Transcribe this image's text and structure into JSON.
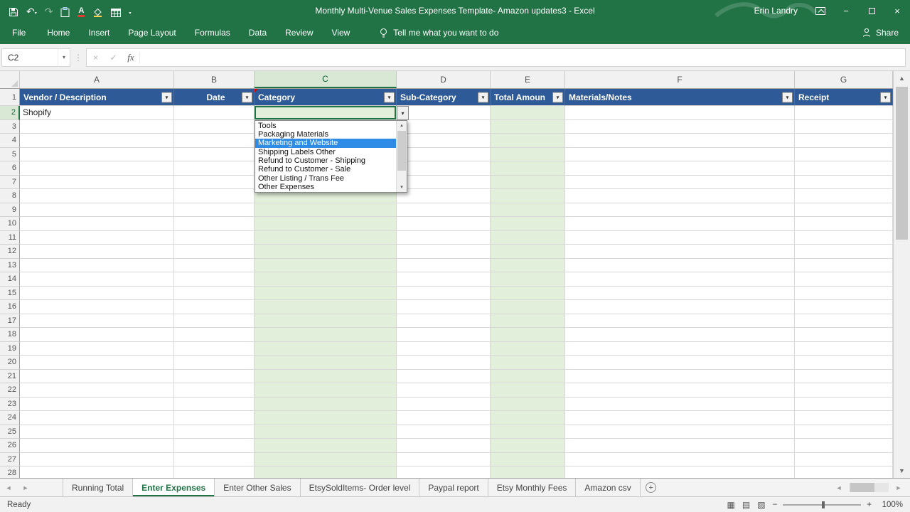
{
  "colors": {
    "excel-green": "#217346",
    "header-blue": "#2E5B97",
    "fill-green": "#E2EFDA",
    "selection-blue": "#2E8BE6",
    "grid-line": "#D8D8D8"
  },
  "titlebar": {
    "title": "Monthly Multi-Venue Sales Expenses Template- Amazon updates3 - Excel",
    "user": "Erin Landry"
  },
  "ribbon": {
    "tabs": [
      "File",
      "Home",
      "Insert",
      "Page Layout",
      "Formulas",
      "Data",
      "Review",
      "View"
    ],
    "tell_me": "Tell me what you want to do",
    "share": "Share"
  },
  "formula_bar": {
    "name_box": "C2",
    "fx": "fx"
  },
  "grid": {
    "columns": [
      "A",
      "B",
      "C",
      "D",
      "E",
      "F",
      "G"
    ],
    "row_count": 28,
    "active_cell": "C2",
    "green_columns": [
      "C",
      "E"
    ],
    "header_row": [
      "Vendor / Description",
      "Date",
      "Category",
      "Sub-Category",
      "Total Amoun",
      "Materials/Notes",
      "Receipt"
    ],
    "cells": {
      "A2": "Shopify"
    }
  },
  "dropdown": {
    "items": [
      "Tools",
      "Packaging Materials",
      "Marketing and Website",
      "Shipping Labels Other",
      "Refund to Customer - Shipping",
      "Refund to Customer - Sale",
      "Other Listing / Trans Fee",
      "Other Expenses"
    ],
    "selected": "Marketing and Website"
  },
  "sheet_tabs": {
    "tabs": [
      "Running Total",
      "Enter Expenses",
      "Enter Other Sales",
      "EtsySoldItems- Order level",
      "Paypal report",
      "Etsy Monthly Fees",
      "Amazon csv"
    ],
    "active": "Enter Expenses"
  },
  "status_bar": {
    "status": "Ready",
    "zoom": "100%"
  },
  "icons": {
    "filter_arrow": "▾",
    "dropdown_arrow": "▾",
    "undo": "↶",
    "redo": "↷",
    "font_color": "A",
    "customize": "▾",
    "scroll_up": "▲",
    "scroll_down": "▼",
    "nav_left": "◄",
    "nav_right": "►",
    "small_up": "▴",
    "small_down": "▾",
    "new_sheet": "+",
    "minimize": "−",
    "close": "×",
    "cancel": "×",
    "check": "✓",
    "ellipsis": "⋮",
    "view_normal": "▦",
    "view_layout": "▤",
    "view_break": "▧",
    "zoom_out": "−",
    "zoom_in": "+"
  }
}
